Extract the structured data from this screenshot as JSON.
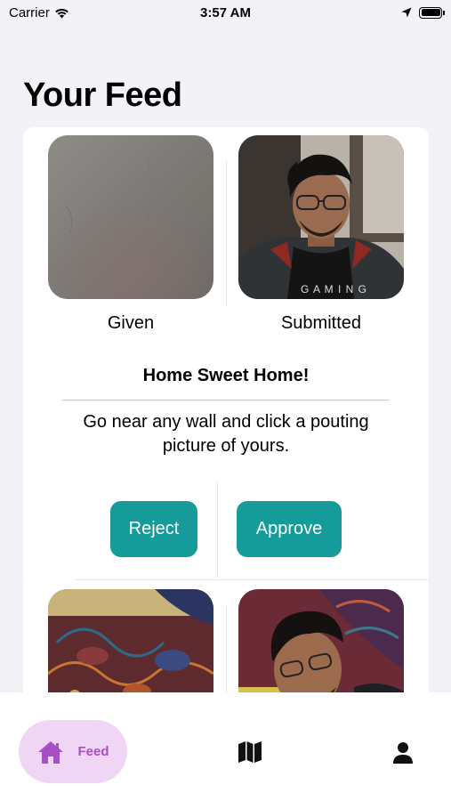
{
  "status_bar": {
    "carrier": "Carrier",
    "time": "3:57 AM",
    "icons": [
      "wifi-icon",
      "location-arrow-icon",
      "battery-icon"
    ]
  },
  "page": {
    "title": "Your Feed"
  },
  "feed": [
    {
      "given_caption": "Given",
      "submitted_caption": "Submitted",
      "task_title": "Home Sweet Home!",
      "task_description": "Go near any wall and click a pouting picture of yours.",
      "reject_label": "Reject",
      "approve_label": "Approve"
    }
  ],
  "tab_bar": {
    "items": [
      {
        "label": "Feed",
        "icon": "house-icon",
        "selected": true
      },
      {
        "label": "",
        "icon": "map-icon",
        "selected": false
      },
      {
        "label": "",
        "icon": "person-icon",
        "selected": false
      }
    ]
  },
  "colors": {
    "accent": "#169b9b",
    "tab_selected_bg": "#f0d6f5",
    "tab_selected_fg": "#a84fc6",
    "background": "#f2f2f7"
  }
}
